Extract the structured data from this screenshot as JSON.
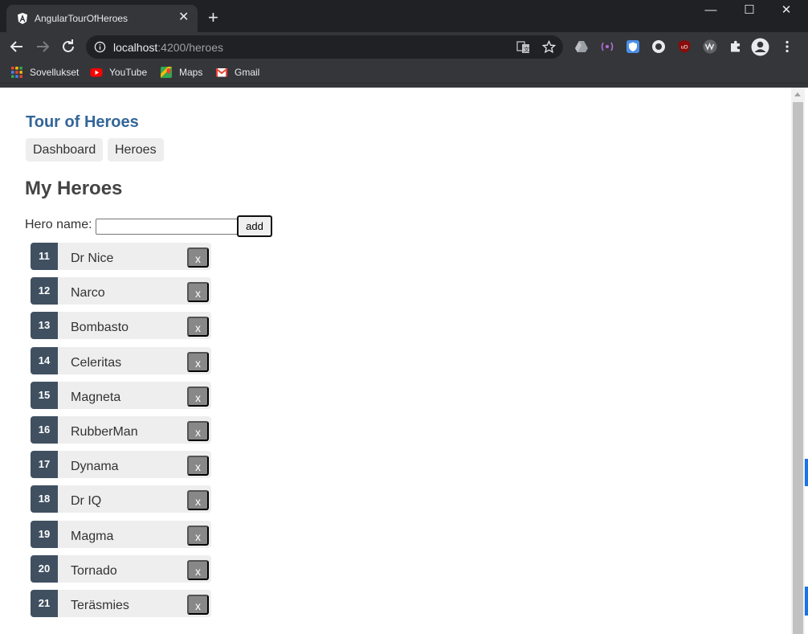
{
  "browser": {
    "tab_title": "AngularTourOfHeroes",
    "tab_close": "✕",
    "new_tab": "+",
    "url_host": "localhost",
    "url_path": ":4200/heroes",
    "window_controls": {
      "minimize": "—",
      "maximize": "☐",
      "close": "✕"
    },
    "bookmarks": [
      {
        "label": "Sovellukset",
        "icon": "apps-grid-icon"
      },
      {
        "label": "YouTube",
        "icon": "youtube-icon"
      },
      {
        "label": "Maps",
        "icon": "maps-icon"
      },
      {
        "label": "Gmail",
        "icon": "gmail-icon"
      }
    ],
    "extensions": [
      "google-drive-icon",
      "podcast-extension-icon",
      "shield-extension-icon",
      "circle-extension-icon",
      "ublock-icon",
      "vv-extension-icon",
      "puzzle-icon",
      "profile-icon",
      "menu-dots-icon"
    ],
    "colors": {
      "chrome_dark": "#202124",
      "chrome_toolbar": "#35363a"
    }
  },
  "app": {
    "title": "Tour of Heroes",
    "nav": [
      {
        "label": "Dashboard"
      },
      {
        "label": "Heroes"
      }
    ],
    "page_title": "My Heroes",
    "hero_name_label": "Hero name:",
    "hero_name_value": "",
    "add_button": "add",
    "delete_label": "x",
    "heroes": [
      {
        "id": "11",
        "name": "Dr Nice"
      },
      {
        "id": "12",
        "name": "Narco"
      },
      {
        "id": "13",
        "name": "Bombasto"
      },
      {
        "id": "14",
        "name": "Celeritas"
      },
      {
        "id": "15",
        "name": "Magneta"
      },
      {
        "id": "16",
        "name": "RubberMan"
      },
      {
        "id": "17",
        "name": "Dynama"
      },
      {
        "id": "18",
        "name": "Dr IQ"
      },
      {
        "id": "19",
        "name": "Magma"
      },
      {
        "id": "20",
        "name": "Tornado"
      },
      {
        "id": "21",
        "name": "Teräsmies"
      }
    ],
    "colors": {
      "title": "#336699",
      "badge": "#405061",
      "delete": "#888888",
      "item_bg": "#eeeeee"
    }
  }
}
